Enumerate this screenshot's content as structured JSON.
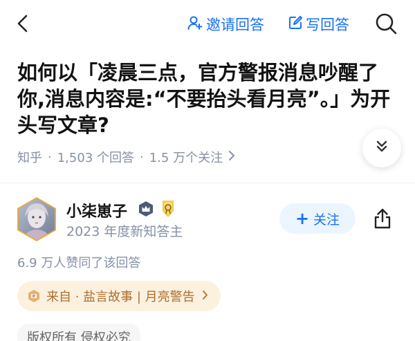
{
  "header": {
    "invite_label": "邀请回答",
    "write_label": "写回答"
  },
  "question": {
    "title": "如何以「凌晨三点，官方警报消息吵醒了你,消息内容是:“不要抬头看月亮”。」为开头写文章?",
    "source": "知乎",
    "answers": "1,503 个回答",
    "followers": "1.5 万个关注",
    "separator": "·"
  },
  "author": {
    "name": "小柒崽子",
    "title": "2023 年度新知答主",
    "follow_label": "关注",
    "badges": [
      "crown-badge-icon",
      "medal-badge-icon"
    ]
  },
  "answer": {
    "upvote_text": "6.9 万人赞同了该回答",
    "source_pill": "来自 · 盐言故事 | 月亮警告",
    "copyright": "版权所有 侵权必究"
  },
  "colors": {
    "accent": "#1772f6",
    "meta": "#8590a6",
    "source_bg": "#fcf1df",
    "source_text": "#ad6f2d",
    "follow_bg": "#ebf5ff"
  }
}
